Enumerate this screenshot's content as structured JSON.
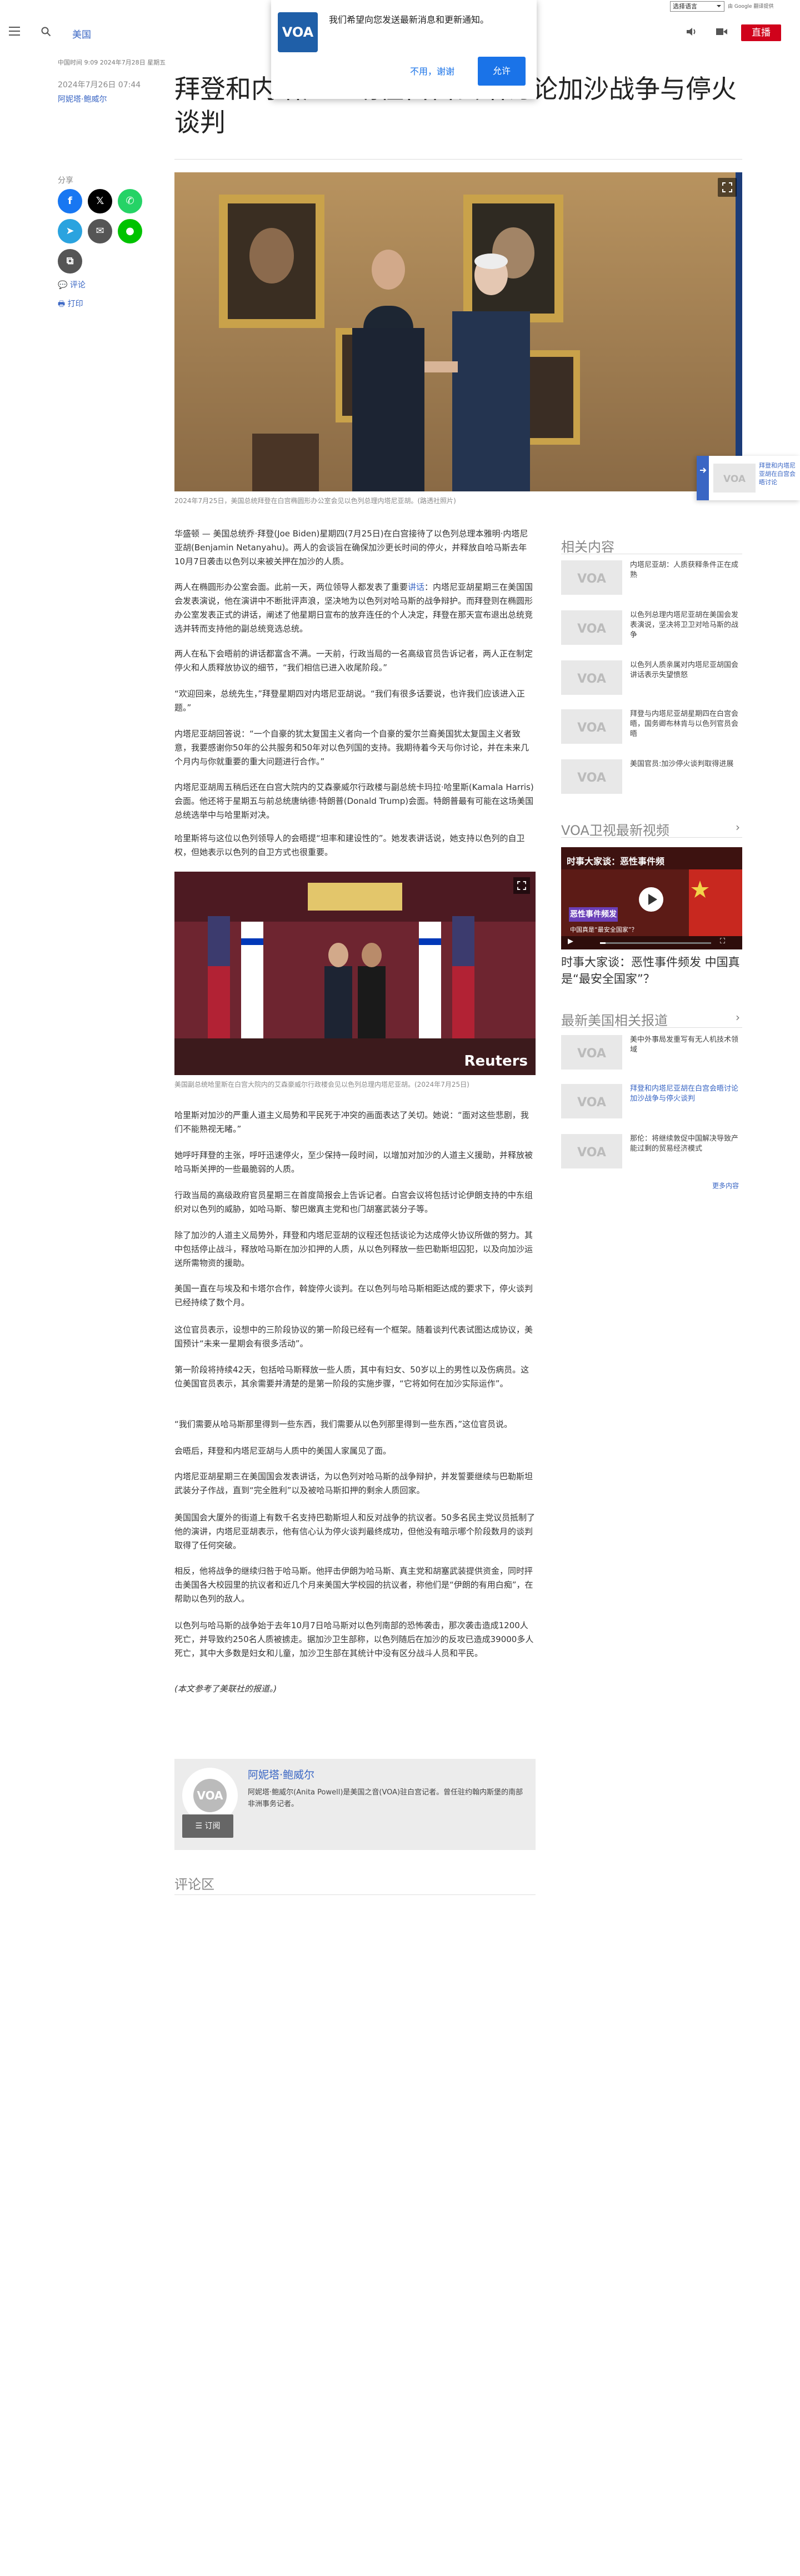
{
  "util": {
    "language_select": "选择语言",
    "translate_note": "由 Google 翻译提供"
  },
  "header": {
    "region": "美国",
    "live": "直播"
  },
  "notification": {
    "message": "我们希望向您发送最新消息和更新通知。",
    "deny": "不用，谢谢",
    "allow": "允许"
  },
  "meta": {
    "top_date": "中国时间 9:09 2024年7月28日 星期五",
    "published": "2024年7月26日 07:44",
    "author": "阿妮塔·鲍威尔"
  },
  "headline": "拜登和内塔尼亚胡在白宫会晤讨论加沙战争与停火谈判",
  "share": {
    "label": "分享",
    "comment": "评论",
    "print": "打印"
  },
  "hero_caption": "2024年7月25日，美国总统拜登在白宫椭圆形办公室会见以色列总理内塔尼亚胡。(路透社照片)",
  "paragraphs": [
    "华盛顿 — 美国总统乔·拜登(Joe Biden)星期四(7月25日)在白宫接待了以色列总理本雅明·内塔尼亚胡(Benjamin Netanyahu)。两人的会谈旨在确保加沙更长时间的停火，并释放自哈马斯去年10月7日袭击以色列以来被关押在加沙的人质。",
    "两人在椭圆形办公室会面。此前一天，两位领导人都发表了重要讲话：内塔尼亚胡星期三在美国国会发表演说，他在演讲中不断批评声浪，坚决地为以色列对哈马斯的战争辩护。而拜登则在椭圆形办公室发表正式的讲话，阐述了他星期日宣布的放弃连任的个人决定，拜登在那天宣布退出总统竞选并转而支持他的副总统竞选总统。",
    "两人在私下会晤前的讲话都富含不满。一天前，行政当局的一名高级官员告诉记者，两人正在制定停火和人质释放协议的细节，“我们相信已进入收尾阶段。”",
    "“欢迎回来，总统先生，”拜登星期四对内塔尼亚胡说。“我们有很多话要说，也许我们应该进入正题。”",
    "内塔尼亚胡回答说：“一个自豪的犹太复国主义者向一个自豪的爱尔兰裔美国犹太复国主义者致意，我要感谢你50年的公共服务和50年对以色列国的支持。我期待着今天与你讨论，并在未来几个月内与你就重要的重大问题进行合作。”",
    "内塔尼亚胡周五稍后还在白宫大院内的艾森豪威尔行政楼与副总统卡玛拉·哈里斯(Kamala Harris)会面。他还将于星期五与前总统唐纳德·特朗普(Donald Trump)会面。特朗普最有可能在这场美国总统选举中与哈里斯对决。",
    "哈里斯将与这位以色列领导人的会晤提“坦率和建设性的”。她发表讲话说，她支持以色列的自卫权，但她表示以色列的自卫方式也很重要。",
    "哈里斯对加沙的严重人道主义局势和平民死于冲突的画面表达了关切。她说：“面对这些悲剧，我们不能熟视无睹。”",
    "她呼吁拜登的主张，呼吁迅速停火，至少保持一段时间，以增加对加沙的人道主义援助，并释放被哈马斯关押的一些最脆弱的人质。",
    "行政当局的高级政府官员星期三在首度简报会上告诉记者。白宫会议将包括讨论伊朗支持的中东组织对以色列的威胁，如哈马斯、黎巴嫩真主党和也门胡塞武装分子等。",
    "除了加沙的人道主义局势外，拜登和内塔尼亚胡的议程还包括谈论为达成停火协议所做的努力。其中包括停止战斗，释放哈马斯在加沙扣押的人质，从以色列释放一些巴勒斯坦囚犯，以及向加沙运送所需物资的援助。",
    "美国一直在与埃及和卡塔尔合作，斡旋停火谈判。在以色列与哈马斯相距达成的要求下，停火谈判已经持续了数个月。",
    "这位官员表示，设想中的三阶段协议的第一阶段已经有一个框架。随着谈判代表试图达成协议，美国预计“未来一星期会有很多活动”。",
    "第一阶段将持续42天，包括哈马斯释放一些人质，其中有妇女、50岁以上的男性以及伤病员。这位美国官员表示，其余需要并清楚的是第一阶段的实施步骤，“它将如何在加沙实际运作”。",
    "“我们需要从哈马斯那里得到一些东西，我们需要从以色列那里得到一些东西，”这位官员说。",
    "会晤后，拜登和内塔尼亚胡与人质中的美国人家属见了面。",
    "内塔尼亚胡星期三在美国国会发表讲话，为以色列对哈马斯的战争辩护，并发誓要继续与巴勒斯坦武装分子作战，直到“完全胜利”以及被哈马斯扣押的剩余人质回家。",
    "美国国会大厦外的街道上有数千名支持巴勒斯坦人和反对战争的抗议者。50多名民主党议员抵制了他的演讲，内塔尼亚胡表示，他有信心认为停火谈判最终成功，但他没有暗示哪个阶段数月的谈判取得了任何突破。",
    "相反，他将战争的继续归咎于哈马斯。他抨击伊朗为哈马斯、真主党和胡塞武装提供资金，同时抨击美国各大校园里的抗议者和近几个月来美国大学校园的抗议者，称他们是“伊朗的有用白痴”，在帮助以色列的敌人。",
    "以色列与哈马斯的战争始于去年10月7日哈马斯对以色列南部的恐怖袭击，那次袭击造成1200人死亡，并导致约250名人质被掳走。据加沙卫生部称，以色列随后在加沙的反攻已造成39000多人死亡，其中大多数是妇女和儿童，加沙卫生部在其统计中没有区分战斗人员和平民。",
    "(本文参考了美联社的报道。)"
  ],
  "inline_links": {
    "speech": "讲话"
  },
  "img2_caption": "美国副总统哈里斯在白宫大院内的艾森豪威尔行政楼会见以色列总理内塔尼亚胡。(2024年7月25日)",
  "img2_credit": "Reuters",
  "author_box": {
    "name": "阿妮塔·鲍威尔",
    "bio": "阿妮塔·鲍威尔(Anita Powell)是美国之音(VOA)驻白宫记者。曾任驻约翰内斯堡的南部非洲事务记者。",
    "subscribe": "订阅"
  },
  "comments_title": "评论区",
  "sidebar": {
    "related_title": "相关内容",
    "related": [
      "内塔尼亚胡：人质获释条件正在成熟",
      "以色列总理内塔尼亚胡在美国会发表演说，坚决将卫卫对哈马斯的战争",
      "以色列人质亲属对内塔尼亚胡国会讲话表示失望愤怒",
      "拜登与内塔尼亚胡星期四在白宫会晤，国务卿布林肯与以色列官员会晤",
      "美国官员:加沙停火谈判取得进展"
    ],
    "video_title": "VOA卫视最新视频",
    "video_overlay": "时事大家谈：恶性事件频",
    "video_banner": "恶性事件频发",
    "video_sub": "中国真是“最安全国家”？",
    "video_caption": "时事大家谈：恶性事件频发 中国真是“最安全国家”？",
    "latest_title": "最新美国相关报道",
    "latest": [
      "美中外事局发重写有无人机技术领域",
      "拜登和内塔尼亚胡在白宫会晤讨论加沙战争与停火谈判",
      "那伦：将继续敦促中国解决导致产能过剩的贸易经济模式"
    ],
    "more": "更多内容"
  },
  "float_widget": {
    "text": "拜登和内塔尼亚胡在白宫会晤讨论"
  },
  "brand": {
    "logo": "VOA",
    "accent": "#3a66c4",
    "live_red": "#d0021b"
  }
}
